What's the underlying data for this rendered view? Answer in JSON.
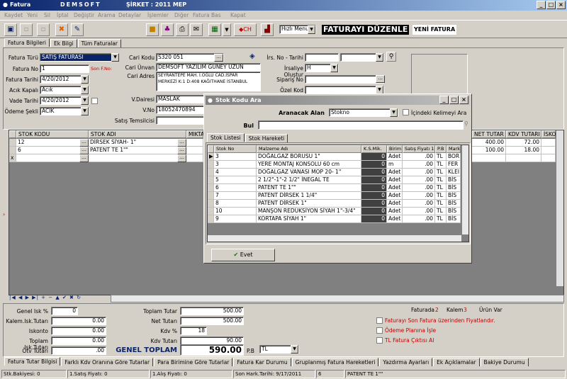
{
  "window": {
    "title": "Fatura",
    "brand": "DEMSOFT",
    "company": "ŞİRKET : 2011 MEP"
  },
  "menu": [
    "Kaydet",
    "Yeni",
    "Sil",
    "İptal",
    "Değiştir",
    "Arama",
    "Detaylar",
    "İşlemler",
    "Diğer",
    "Fatura Bas",
    "Kapat"
  ],
  "toolbar": {
    "menu_select": "Hızlı Menu",
    "mode_title": "FATURAYI DÜZENLE",
    "mode_sub": "YENİ FATURA",
    "currency": "CH"
  },
  "tabs_top": [
    "Fatura Bilgileri",
    "Ek Bilgi",
    "Tüm Faturalar"
  ],
  "form": {
    "fatura_turu_label": "Fatura Türü",
    "fatura_turu": "SATIŞ FATURASI",
    "fatura_no_label": "Fatura No",
    "fatura_no": "1",
    "son_fno_label": "Son F.No:",
    "fatura_tarihi_label": "Fatura Tarihi",
    "fatura_tarihi": "4/20/2012",
    "acik_kapali_label": "Acık Kapalı",
    "acik_kapali": "Acık",
    "vade_tarihi_label": "Vade Tarihi",
    "vade_tarihi": "4/20/2012",
    "odeme_sekli_label": "Ödeme Şekli",
    "odeme_sekli": "ACIK",
    "cari_kodu_label": "Cari Kodu",
    "cari_kodu": "S320 051",
    "cari_unvan_label": "Cari Ünvan",
    "cari_unvan": "DEMSOFT YAZILIM GÜNEY UZUN",
    "cari_adres_label": "Cari Adres",
    "cari_adres_1": "SEYRANTEPE MAH. İ.OĞLU CAD.İSPAR",
    "cari_adres_2": "MERKEZİ K:1 D:408 KAĞITHANE İSTANBUL",
    "vdairesi_label": "V.Dairesi",
    "vdairesi": "MASLAK",
    "vno_label": "V.No",
    "vno": "18052470894",
    "satis_temsilcisi_label": "Satış Temsilcisi",
    "irs_no_label": "İrs. No - Tarihi",
    "irsaliye_label": "İrsaliye Oluştur",
    "irsaliye": "H",
    "siparis_label": "Sipariş No",
    "ozel_kod_label": "Özel Kod"
  },
  "grid": {
    "headers": [
      "STOK KODU",
      "STOK ADI",
      "MIKTA"
    ],
    "right_headers": [
      "NET TUTAR",
      "KDV TUTARI",
      "İSKO"
    ],
    "rows": [
      {
        "kod": "12",
        "adi": "DİRSEK SİYAH- 1\"",
        "net": "400.00",
        "kdv": "72.00"
      },
      {
        "kod": "6",
        "adi": "PATENT TE 1\"\"",
        "net": "100.00",
        "kdv": "18.00"
      },
      {
        "kod": "",
        "adi": "",
        "net": "",
        "kdv": ""
      }
    ],
    "row_marks": [
      "",
      "",
      "x"
    ]
  },
  "dialog": {
    "title": "Stok Kodu Ara",
    "aranacak_label": "Aranacak Alan",
    "aranacak": "Stokno",
    "icindeki_label": "İçindeki Kelimeyi Ara",
    "bul_label": "Bul",
    "tabs": [
      "Stok Listesi",
      "Stok Hareketi"
    ],
    "headers": [
      "Stok No",
      "Malzeme Adı",
      "K.S.Mik.",
      "Birim",
      "Satış Fiyatı 1",
      "P.B",
      "Mark"
    ],
    "rows": [
      [
        "3",
        "DOĞALGAZ BORUSU 1\"",
        "0",
        "Adet",
        ".00",
        "TL",
        "BOR"
      ],
      [
        "3",
        "YERE MONTAJ KONSOLU 60 cm",
        "0",
        "m",
        ".00",
        "TL",
        "FER"
      ],
      [
        "4",
        "DOĞALGAZ VANASI MOP 20- 1\"",
        "0",
        "Adet",
        ".00",
        "TL",
        "KLEI"
      ],
      [
        "5",
        "2 1/2\"-1\"-2 1/2\" İNEGAL TE",
        "0",
        "Adet",
        ".00",
        "TL",
        "BİS"
      ],
      [
        "6",
        "PATENT TE 1\"\"",
        "0",
        "Adet",
        ".00",
        "TL",
        "BİS"
      ],
      [
        "7",
        "PATENT DİRSEK 1 1/4\"",
        "0",
        "Adet",
        ".00",
        "TL",
        "BİS"
      ],
      [
        "8",
        "PATENT DİRSEK 1\"",
        "0",
        "Adet",
        ".00",
        "TL",
        "BİS"
      ],
      [
        "10",
        "MANŞON REDÜKSİYON SİYAH 1\"-3/4\"",
        "0",
        "Adet",
        ".00",
        "TL",
        "BİS"
      ],
      [
        "9",
        "KÖRTAPA SİYAH 1\"",
        "0",
        "Adet",
        ".00",
        "TL",
        "BİS"
      ]
    ],
    "ok_label": "Evet"
  },
  "totals": {
    "genel_isk_label": "Genel Isk %",
    "genel_isk": "0",
    "kalem_isk_label": "Kalem.Isk.Tutarı",
    "kalem_isk": "0.00",
    "iskonto_label": "Iskonto",
    "iskonto": "0.00",
    "toplam_isk_label": "Toplam Isk.Tutarı",
    "toplam_isk": "0.00",
    "otv_label": "Ötv Tutarı",
    "otv": ".00",
    "toplam_tutar_label": "Toplam Tutar",
    "toplam_tutar": "500.00",
    "net_tutar_label": "Net Tutarı",
    "net_tutar": "500.00",
    "kdv_pct_label": "Kdv %",
    "kdv_pct": "18",
    "kdv_tutar_label": "Kdv Tutarı",
    "kdv_tutar": "90.00",
    "genel_toplam_label": "GENEL TOPLAM",
    "genel_toplam": "590.00",
    "pb_label": "P.B",
    "pb": "TL",
    "faturada_label": "Faturada",
    "faturada": "2",
    "kalem_label": "Kalem",
    "kalem": "3",
    "urun_var_label": "Ürün Var",
    "opt1": "Faturayı Son Fatura üzerinden Fiyatlandır.",
    "opt2": "Ödeme Planına İşle",
    "opt3": "TL Fatura Çıktısı Al"
  },
  "tabs_bottom": [
    "Fatura Tutar Bilgisi",
    "Farklı Kdv Oranına Göre Tutarlar",
    "Para Birimine Göre Tutarlar",
    "Fatura Kar Durumu",
    "Gruplanmış Fatura Hareketleri",
    "Yazdırma Ayarları",
    "Ek Açıklamalar",
    "Bakiye Durumu"
  ],
  "status": {
    "stk_bakiyesi": "Stk.Bakiyesi: 0",
    "satis_fiyati": "1.Satış Fiyatı: 0",
    "alis_fiyati": "1.Alış Fiyatı: 0",
    "son_hark": "Son Hark.Tarihi: 9/17/2011",
    "kod": "6",
    "adi": "PATENT TE 1\"\""
  },
  "colors": {
    "title_blue": "#0a246a",
    "dialog_title": "#808080",
    "accent_red": "#c00000",
    "selection": "#0a246a"
  }
}
